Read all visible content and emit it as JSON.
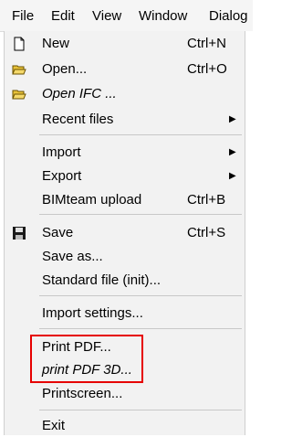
{
  "menubar": {
    "items": [
      "File",
      "Edit",
      "View",
      "Window",
      "Dialog"
    ]
  },
  "file_menu": {
    "new": {
      "label": "New",
      "shortcut": "Ctrl+N"
    },
    "open": {
      "label": "Open...",
      "shortcut": "Ctrl+O"
    },
    "open_ifc": {
      "label": "Open IFC ..."
    },
    "recent_files": {
      "label": "Recent files"
    },
    "import": {
      "label": "Import"
    },
    "export": {
      "label": "Export"
    },
    "bimteam_upload": {
      "label": "BIMteam upload",
      "shortcut": "Ctrl+B"
    },
    "save": {
      "label": "Save",
      "shortcut": "Ctrl+S"
    },
    "save_as": {
      "label": "Save as..."
    },
    "standard_file": {
      "label": "Standard file (init)..."
    },
    "import_settings": {
      "label": "Import settings..."
    },
    "print_pdf": {
      "label": "Print PDF..."
    },
    "print_pdf_3d": {
      "label": "print PDF 3D..."
    },
    "printscreen": {
      "label": "Printscreen..."
    },
    "exit": {
      "label": "Exit"
    }
  },
  "icons": {
    "new": "new-document-icon",
    "open": "open-folder-icon",
    "open_ifc": "open-folder-icon",
    "save": "floppy-disk-icon",
    "submenu": "submenu-arrow-icon"
  },
  "colors": {
    "highlight_border": "#e60000",
    "menu_background": "#f2f2f2",
    "folder_yellow": "#e8c23a"
  }
}
